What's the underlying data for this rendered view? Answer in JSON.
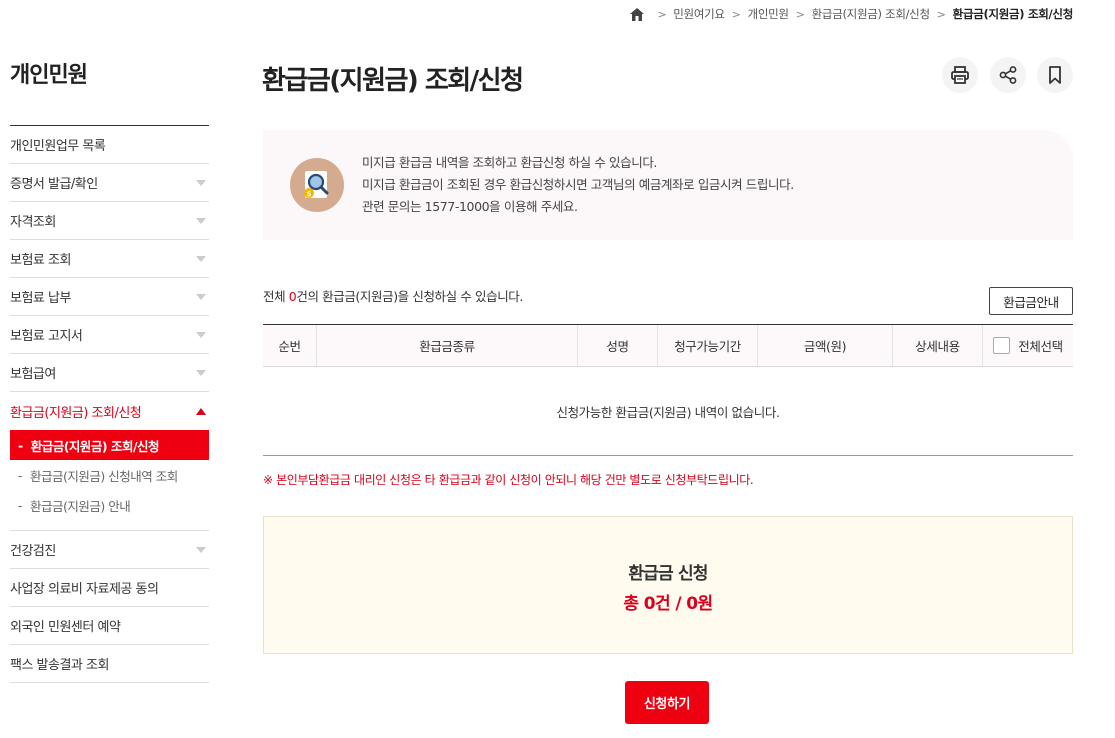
{
  "breadcrumb": {
    "items": [
      "민원여기요",
      "개인민원",
      "환급금(지원금) 조회/신청",
      "환급금(지원금) 조회/신청"
    ]
  },
  "sidebar": {
    "title": "개인민원",
    "items": [
      {
        "label": "개인민원업무 목록"
      },
      {
        "label": "증명서 발급/확인"
      },
      {
        "label": "자격조회"
      },
      {
        "label": "보험료 조회"
      },
      {
        "label": "보험료 납부"
      },
      {
        "label": "보험료 고지서"
      },
      {
        "label": "보험급여"
      },
      {
        "label": "환급금(지원금) 조회/신청"
      },
      {
        "label": "건강검진"
      },
      {
        "label": "사업장 의료비 자료제공 동의"
      },
      {
        "label": "외국인 민원센터 예약"
      },
      {
        "label": "팩스 발송결과 조회"
      }
    ],
    "sub_items": [
      {
        "label": "환급금(지원금) 조회/신청"
      },
      {
        "label": "환급금(지원금) 신청내역 조회"
      },
      {
        "label": "환급금(지원금) 안내"
      }
    ]
  },
  "page": {
    "title": "환급금(지원금) 조회/신청"
  },
  "info": {
    "line1": "미지급 환급금 내역을 조회하고 환급신청 하실 수 있습니다.",
    "line2": "미지급 환급금이 조회된 경우 환급신청하시면 고객님의 예금계좌로 입금시켜 드립니다.",
    "line3": "관련 문의는 1577-1000을 이용해 주세요."
  },
  "count": {
    "prefix": "전체 ",
    "num": "0",
    "suffix": "건의 환급금(지원금)을 신청하실 수 있습니다."
  },
  "guide_button": "환급금안내",
  "table": {
    "headers": [
      "순번",
      "환급금종류",
      "성명",
      "청구가능기간",
      "금액(원)",
      "상세내용",
      "전체선택"
    ],
    "empty": "신청가능한 환급금(지원금) 내역이 없습니다."
  },
  "notice": "※ 본인부담환급금 대리인 신청은 타 환급금과 같이 신청이 안되니 해당 건만 별도로 신청부탁드립니다.",
  "summary": {
    "title": "환급금 신청",
    "total": "총 0건 / 0원"
  },
  "apply_button": "신청하기",
  "colors": {
    "accent": "#ee0010",
    "accent_text": "#d8001a",
    "info_bg": "#fcf7f8",
    "summary_bg": "#fffbef"
  },
  "icons": [
    "home-icon",
    "print-icon",
    "share-icon",
    "bookmark-icon",
    "search-refund-icon",
    "chevron-down-icon",
    "chevron-up-icon"
  ]
}
